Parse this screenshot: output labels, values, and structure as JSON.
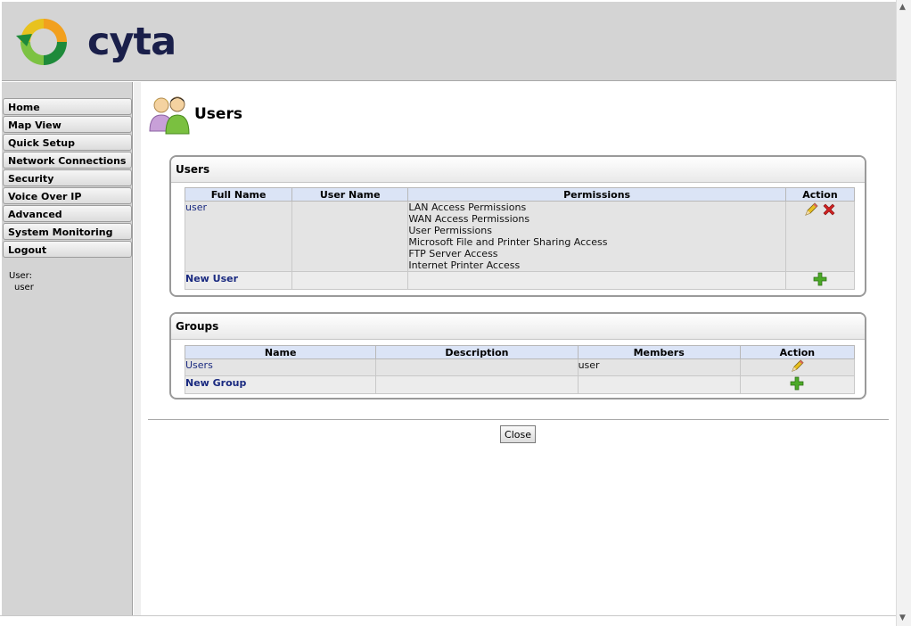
{
  "brand": {
    "name": "cyta"
  },
  "nav": {
    "items": [
      {
        "label": "Home"
      },
      {
        "label": "Map View"
      },
      {
        "label": "Quick Setup"
      },
      {
        "label": "Network Connections"
      },
      {
        "label": "Security"
      },
      {
        "label": "Voice Over IP"
      },
      {
        "label": "Advanced"
      },
      {
        "label": "System Monitoring"
      },
      {
        "label": "Logout"
      }
    ],
    "user_label": "User:",
    "user_value": "user"
  },
  "page": {
    "title": "Users"
  },
  "users_panel": {
    "title": "Users",
    "columns": [
      "Full Name",
      "User Name",
      "Permissions",
      "Action"
    ],
    "rows": [
      {
        "full_name": "user",
        "permissions": [
          "LAN Access Permissions",
          "WAN Access Permissions",
          "User Permissions",
          "Microsoft File and Printer Sharing Access",
          "FTP Server Access",
          "Internet Printer Access"
        ]
      }
    ],
    "new_label": "New User"
  },
  "groups_panel": {
    "title": "Groups",
    "columns": [
      "Name",
      "Description",
      "Members",
      "Action"
    ],
    "rows": [
      {
        "name": "Users",
        "description": "",
        "members": "user"
      }
    ],
    "new_label": "New Group"
  },
  "footer": {
    "close_label": "Close"
  },
  "icons": {
    "logo": "cyta-swirl-logo",
    "page": "users-icon",
    "edit": "pencil-edit-icon",
    "delete": "red-x-delete-icon",
    "add": "green-plus-icon"
  },
  "colors": {
    "link": "#1a2a80",
    "header_bg": "#d4d4d4",
    "column_header_bg": "#dbe4f6",
    "delete": "#d02020",
    "add": "#4caa28"
  }
}
